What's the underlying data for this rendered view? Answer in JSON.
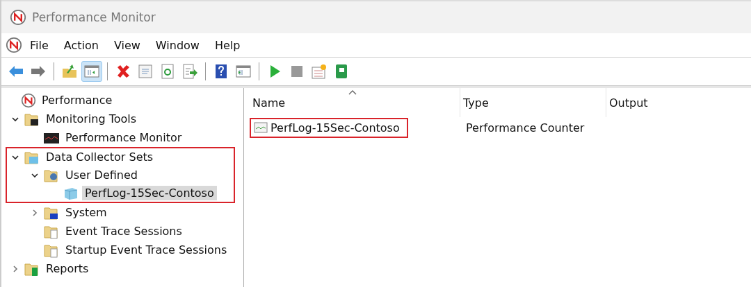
{
  "window": {
    "title": "Performance Monitor"
  },
  "menu": [
    "File",
    "Action",
    "View",
    "Window",
    "Help"
  ],
  "toolbar": [
    {
      "kind": "back",
      "selected": false
    },
    {
      "kind": "forward",
      "selected": false
    },
    {
      "kind": "separator"
    },
    {
      "kind": "up-folder",
      "selected": false
    },
    {
      "kind": "console-tree",
      "selected": true
    },
    {
      "kind": "separator"
    },
    {
      "kind": "delete",
      "selected": false
    },
    {
      "kind": "properties",
      "selected": false
    },
    {
      "kind": "refresh",
      "selected": false
    },
    {
      "kind": "export",
      "selected": false
    },
    {
      "kind": "separator"
    },
    {
      "kind": "help",
      "selected": false
    },
    {
      "kind": "action-pane",
      "selected": false
    },
    {
      "kind": "separator"
    },
    {
      "kind": "start",
      "selected": false
    },
    {
      "kind": "stop",
      "selected": false
    },
    {
      "kind": "new",
      "selected": false
    },
    {
      "kind": "book",
      "selected": false
    }
  ],
  "tree": [
    {
      "label": "Performance",
      "kind": "perf",
      "selected": false,
      "highlighted": false,
      "children": [
        {
          "label": "Monitoring Tools",
          "kind": "folder-monitor",
          "expanded": true,
          "selected": false,
          "highlighted": false,
          "children": [
            {
              "label": "Performance Monitor",
              "kind": "monitor-chart",
              "selected": false,
              "highlighted": false
            }
          ]
        },
        {
          "label": "Data Collector Sets",
          "kind": "folder-data",
          "expanded": true,
          "selected": false,
          "highlighted": true,
          "children": [
            {
              "label": "User Defined",
              "kind": "folder-user",
              "expanded": true,
              "selected": false,
              "highlighted": true,
              "children": [
                {
                  "label": "PerfLog-15Sec-Contoso",
                  "kind": "cube",
                  "selected": true,
                  "highlighted": true
                }
              ]
            },
            {
              "label": "System",
              "kind": "folder-system",
              "expanded": false,
              "selected": false,
              "highlighted": false
            },
            {
              "label": "Event Trace Sessions",
              "kind": "folder-trace",
              "selected": false,
              "highlighted": false
            },
            {
              "label": "Startup Event Trace Sessions",
              "kind": "folder-trace",
              "selected": false,
              "highlighted": false
            }
          ]
        },
        {
          "label": "Reports",
          "kind": "folder-reports",
          "expanded": false,
          "selected": false,
          "highlighted": false
        }
      ]
    }
  ],
  "list": {
    "columns": [
      {
        "label": "Name",
        "sorted": true
      },
      {
        "label": "Type",
        "sorted": false
      },
      {
        "label": "Output",
        "sorted": false
      }
    ],
    "rows": [
      {
        "name": "PerfLog-15Sec-Contoso",
        "type": "Performance Counter",
        "highlighted": true
      }
    ]
  }
}
